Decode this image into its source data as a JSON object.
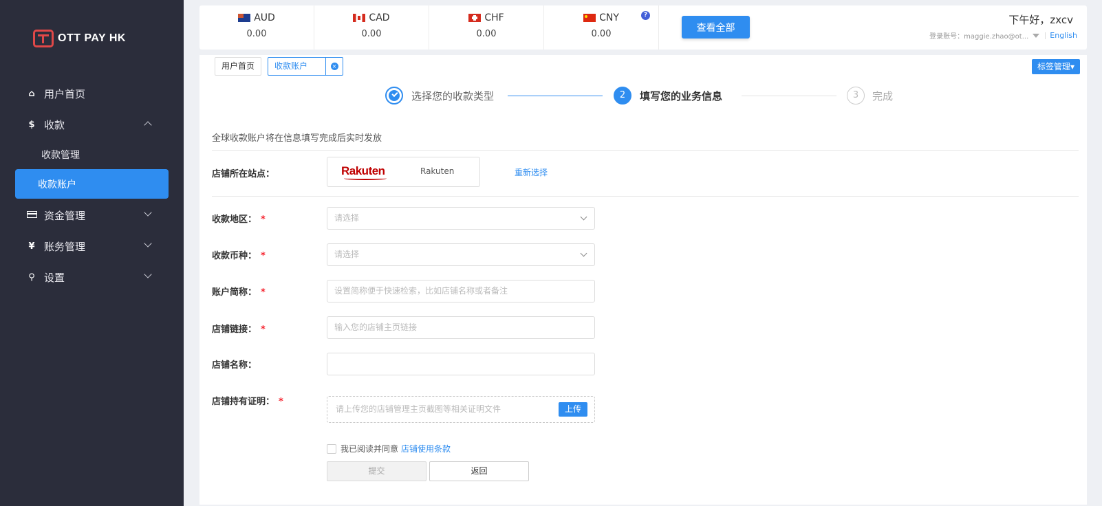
{
  "brand": {
    "logo_text": "OTT PAY HK"
  },
  "sidebar": {
    "items": [
      {
        "label": "用户首页",
        "icon": "home-icon"
      },
      {
        "label": "收款",
        "icon": "dollar-icon"
      },
      {
        "label": "收款管理"
      },
      {
        "label": "收款账户"
      },
      {
        "label": "资金管理",
        "icon": "card-icon"
      },
      {
        "label": "账务管理",
        "icon": "yen-icon"
      },
      {
        "label": "设置",
        "icon": "search-icon"
      }
    ],
    "active_item": "收款账户"
  },
  "currencies": [
    {
      "code": "AUD",
      "value": "0.00"
    },
    {
      "code": "CAD",
      "value": "0.00"
    },
    {
      "code": "CHF",
      "value": "0.00"
    },
    {
      "code": "CNY",
      "value": "0.00"
    }
  ],
  "header": {
    "help_badge": "?",
    "view_all": "查看全部",
    "greeting": "下午好，zxcv",
    "account_label": "登录账号：maggie.zhao@ot...",
    "language": "English"
  },
  "tabs": {
    "items": [
      "用户首页",
      "收款账户"
    ],
    "close_symbol": "×",
    "tag_manager": "标签管理▾"
  },
  "steps": [
    {
      "number": "",
      "label": "选择您的收款类型",
      "state": "done"
    },
    {
      "number": "2",
      "label": "填写您的业务信息",
      "state": "active"
    },
    {
      "number": "3",
      "label": "完成",
      "state": "pending"
    }
  ],
  "form": {
    "notice": "全球收款账户将在信息填写完成后实时发放",
    "site_label": "店铺所在站点：",
    "site_logo": "Rakuten",
    "site_name": "Rakuten",
    "reselect": "重新选择",
    "region_label": "收款地区：",
    "region_placeholder": "请选择",
    "currency_label": "收款币种：",
    "currency_placeholder": "请选择",
    "alias_label": "账户简称：",
    "alias_placeholder": "设置简称便于快速检索，比如店铺名称或者备注",
    "link_label": "店铺链接：",
    "link_placeholder": "输入您的店铺主页链接",
    "name_label": "店铺名称：",
    "name_value": "",
    "proof_label": "店铺持有证明：",
    "proof_placeholder": "请上传您的店铺管理主页截图等相关证明文件",
    "upload_button": "上传",
    "required_mark": "*",
    "agree_text": "我已阅读并同意",
    "terms_link": "店铺使用条款",
    "submit": "提交",
    "back": "返回"
  },
  "colors": {
    "accent": "#2f8df0",
    "sidebar_bg": "#2b2d3b",
    "required": "#f5222d",
    "rakuten": "#bf0000"
  }
}
